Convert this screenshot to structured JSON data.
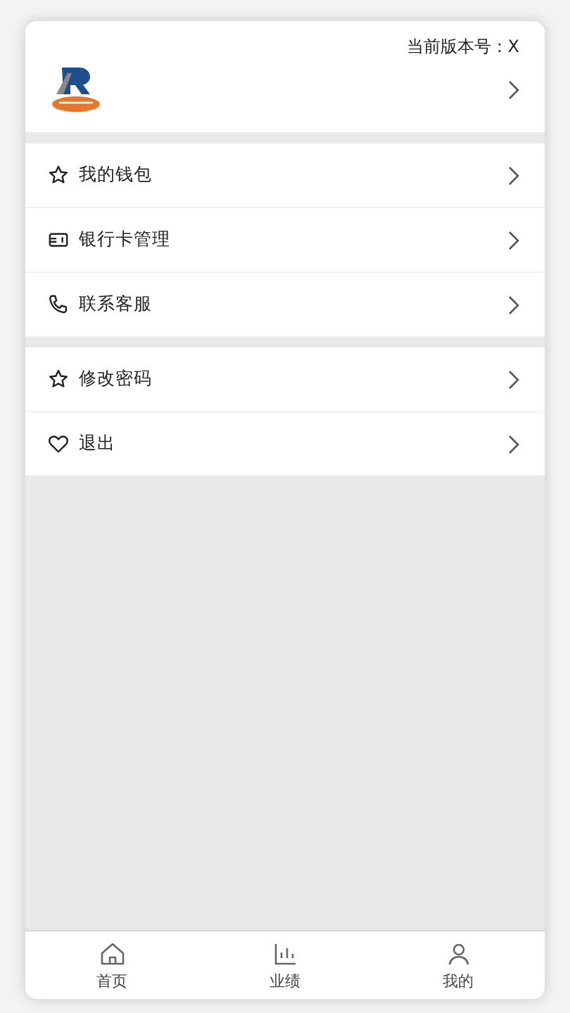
{
  "header": {
    "version_label": "当前版本号：X"
  },
  "menu_groups": [
    {
      "items": [
        {
          "label": "我的钱包"
        },
        {
          "label": "银行卡管理"
        },
        {
          "label": "联系客服"
        }
      ]
    },
    {
      "items": [
        {
          "label": "修改密码"
        },
        {
          "label": "退出"
        }
      ]
    }
  ],
  "tab_bar": [
    {
      "label": "首页"
    },
    {
      "label": "业绩"
    },
    {
      "label": "我的"
    }
  ]
}
